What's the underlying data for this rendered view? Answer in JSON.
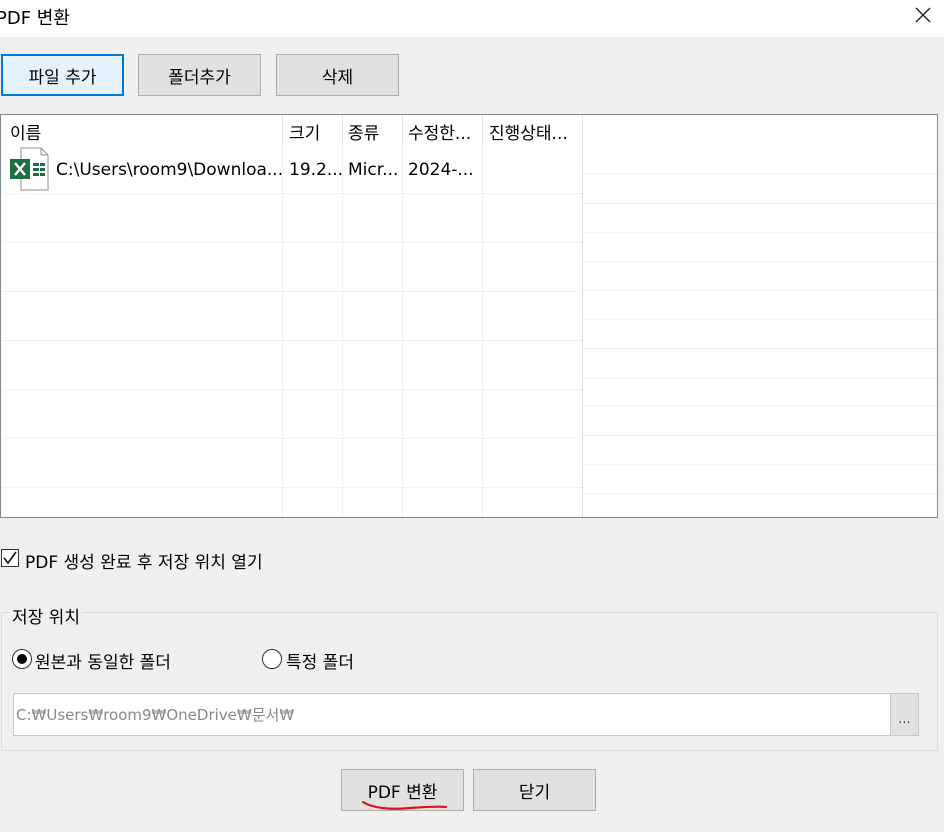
{
  "window": {
    "title": "PDF 변환"
  },
  "toolbar": {
    "add_file": "파일 추가",
    "add_folder": "폴더추가",
    "delete": "삭제"
  },
  "file_list": {
    "columns": [
      "이름",
      "크기",
      "종류",
      "수정한...",
      "진행상태..."
    ],
    "rows": [
      {
        "name": "C:\\Users\\room9\\Downloa...",
        "size": "19.2...",
        "type": "Micr...",
        "modified": "2024-...",
        "status": ""
      }
    ]
  },
  "open_after": {
    "label": "PDF 생성 완료 후 저장 위치 열기",
    "checked": true
  },
  "save_location": {
    "title": "저장 위치",
    "option_same": "원본과 동일한 폴더",
    "option_specific": "특정 폴더",
    "selected": "same",
    "path": "C:₩Users₩room9₩OneDrive₩문서₩",
    "browse": "..."
  },
  "footer": {
    "convert": "PDF 변환",
    "close": "닫기"
  },
  "colors": {
    "accent": "#0078d7",
    "excel_green": "#1d6f42",
    "annotation_red": "#e0101a"
  }
}
